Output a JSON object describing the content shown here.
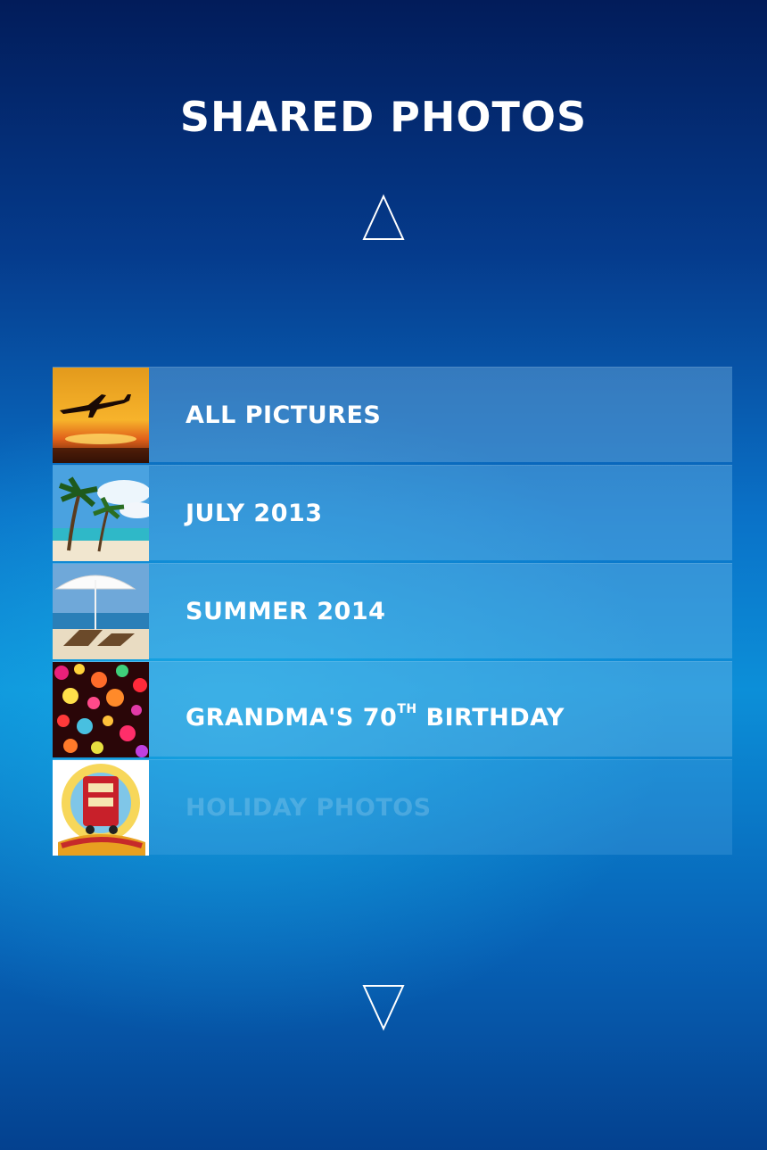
{
  "header": {
    "title": "SHARED PHOTOS"
  },
  "nav": {
    "up_icon": "triangle-up-icon",
    "down_icon": "triangle-down-icon"
  },
  "albums": [
    {
      "label": "ALL PICTURES",
      "thumb": "airplane-sunset"
    },
    {
      "label": "JULY 2013",
      "thumb": "palm-beach"
    },
    {
      "label": "SUMMER 2014",
      "thumb": "umbrella-beach"
    },
    {
      "label_main": "GRANDMA'S 70",
      "label_sup": "TH",
      "label_end": " BIRTHDAY",
      "thumb": "bokeh-lights"
    },
    {
      "label": "HOLIDAY PHOTOS",
      "thumb": "summer-holiday-badge"
    }
  ],
  "colors": {
    "background_top": "#021c5a",
    "background_mid": "#0c8fd8",
    "text": "#ffffff"
  }
}
